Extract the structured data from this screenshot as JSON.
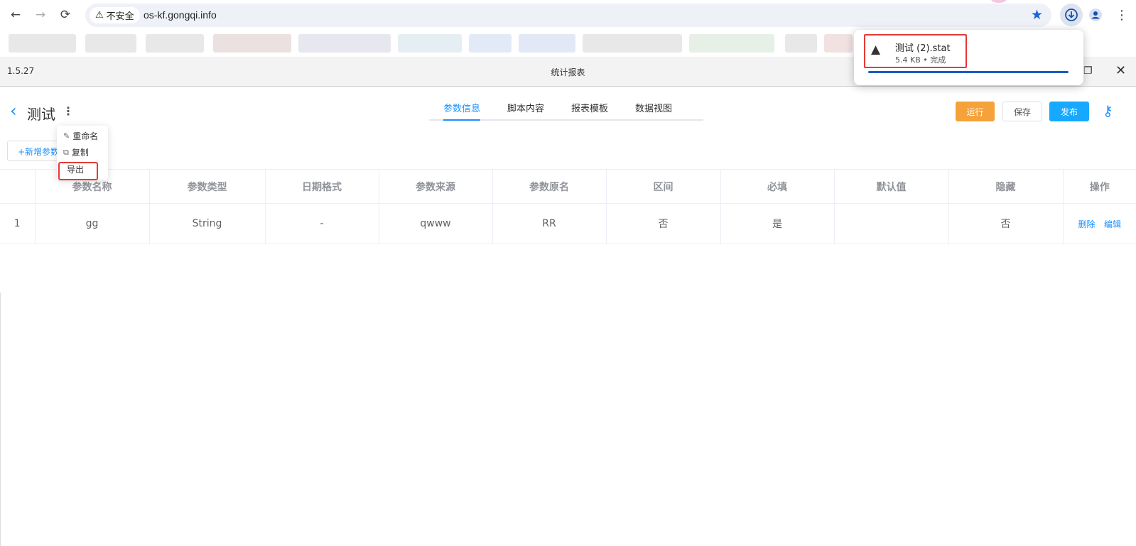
{
  "browser": {
    "back_label": "←",
    "forward_label": "→",
    "reload_label": "⟳",
    "security_label": "不安全",
    "url": "os-kf.gongqi.info"
  },
  "app": {
    "version": "1.5.27",
    "title": "统计报表"
  },
  "page": {
    "title": "测试",
    "tabs": [
      {
        "label": "参数信息",
        "active": true
      },
      {
        "label": "脚本内容",
        "active": false
      },
      {
        "label": "报表模板",
        "active": false
      },
      {
        "label": "数据视图",
        "active": false
      }
    ],
    "buttons": {
      "run": "运行",
      "save": "保存",
      "publish": "发布"
    },
    "add_param": "+新增参数"
  },
  "dropdown": {
    "rename": "重命名",
    "copy": "复制",
    "export": "导出"
  },
  "table": {
    "headers": [
      "",
      "参数名称",
      "参数类型",
      "日期格式",
      "参数来源",
      "参数原名",
      "区间",
      "必填",
      "默认值",
      "隐藏",
      "操作"
    ],
    "rows": [
      {
        "index": "1",
        "name": "gg",
        "type": "String",
        "date_format": "-",
        "source": "qwww",
        "original_name": "RR",
        "range": "否",
        "required": "是",
        "default": "",
        "hidden": "否",
        "delete": "删除",
        "edit": "编辑"
      }
    ]
  },
  "download": {
    "filename": "测试 (2).stat",
    "status": "5.4 KB • 完成",
    "progress": 1.0
  },
  "colors": {
    "accent": "#1a90ff",
    "run": "#f5a23a",
    "publish": "#17a8ff",
    "highlight": "#e53935"
  }
}
